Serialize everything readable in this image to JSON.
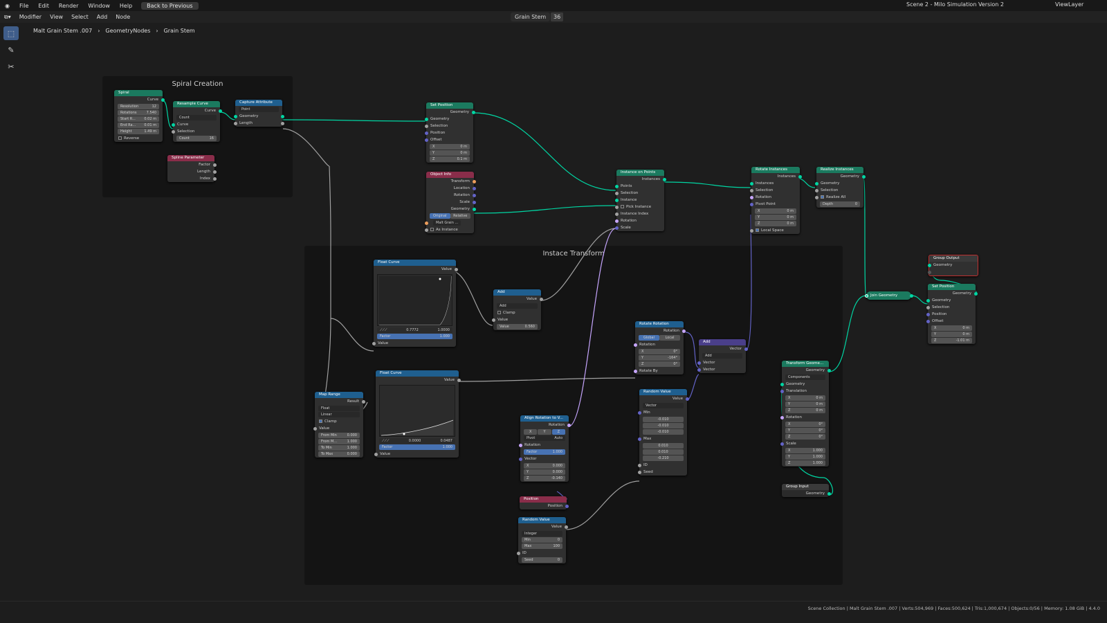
{
  "menu": {
    "editor_label": "Modifier",
    "items": [
      "File",
      "Edit",
      "Render",
      "Window",
      "Help"
    ],
    "back_button": "Back to Previous",
    "scene": "Scene 2 - Milo Simulation Version 2",
    "view_layer": "ViewLayer"
  },
  "header": {
    "items": [
      "View",
      "Select",
      "Add",
      "Node"
    ],
    "node_group": "Grain Stem",
    "user_count": "36"
  },
  "breadcrumb": {
    "object": "Malt Grain Stem .007",
    "modifier": "GeometryNodes",
    "group": "Grain Stem"
  },
  "frames": {
    "spiral": "Spiral Creation",
    "instance": "Instace Transform"
  },
  "nodes": {
    "spiral": {
      "title": "Spiral",
      "out": "Curve",
      "resolution": [
        "Resolution",
        "12"
      ],
      "rotations": [
        "Rotations",
        "7.540"
      ],
      "start": [
        "Start R...",
        "0.02 m"
      ],
      "end": [
        "End Ra...",
        "0.01 m"
      ],
      "height": [
        "Height",
        "1.49 m"
      ],
      "reverse": "Reverse"
    },
    "resample": {
      "title": "Resample Curve",
      "out": "Curve",
      "mode": "Count",
      "in": "Curve",
      "selection": "Selection",
      "count": [
        "Count",
        "16"
      ]
    },
    "capture": {
      "title": "Capture Attribute",
      "domain": "Point",
      "geometry": "Geometry",
      "length": "Length"
    },
    "spline": {
      "title": "Spline Parameter",
      "factor": "Factor",
      "length": "Length",
      "index": "Index"
    },
    "setpos1": {
      "title": "Set Position",
      "out": "Geometry",
      "geometry": "Geometry",
      "selection": "Selection",
      "position": "Position",
      "offset": "Offset",
      "x": [
        "X",
        "0 m"
      ],
      "y": [
        "Y",
        "0 m"
      ],
      "z": [
        "Z",
        "0.1 m"
      ]
    },
    "objinfo": {
      "title": "Object Info",
      "transform": "Transform",
      "location": "Location",
      "rotation": "Rotation",
      "scale": "Scale",
      "geometry": "Geometry",
      "original": "Original",
      "relative": "Relative",
      "object": "Malt Grain ...",
      "as_instance": "As Instance"
    },
    "iop": {
      "title": "Instance on Points",
      "out": "Instances",
      "points": "Points",
      "selection": "Selection",
      "instance": "Instance",
      "pick": "Pick Instance",
      "index": "Instance Index",
      "rotation": "Rotation",
      "scale": "Scale"
    },
    "rotinst": {
      "title": "Rotate Instances",
      "out": "Instances",
      "instances": "Instances",
      "selection": "Selection",
      "rotation": "Rotation",
      "pivot": "Pivot Point",
      "x": [
        "X",
        "0 m"
      ],
      "y": [
        "Y",
        "0 m"
      ],
      "z": [
        "Z",
        "0 m"
      ],
      "local": "Local Space"
    },
    "realize": {
      "title": "Realize Instances",
      "out": "Geometry",
      "geometry": "Geometry",
      "selection": "Selection",
      "realize_all": "Realize All",
      "depth": [
        "Depth",
        "0"
      ]
    },
    "floatcurve1": {
      "title": "Float Curve",
      "out": "Value",
      "pt": [
        "0.7772",
        "1.0000"
      ],
      "factor": [
        "Factor",
        "1.000"
      ],
      "value": "Value"
    },
    "floatcurve2": {
      "title": "Float Curve",
      "out": "Value",
      "pt": [
        "0.0000",
        "0.0487"
      ],
      "factor": [
        "Factor",
        "1.000"
      ],
      "value": "Value"
    },
    "add1": {
      "title": "Add",
      "out": "Value",
      "op": "Add",
      "clamp": "Clamp",
      "value": "Value",
      "value_field": [
        "Value",
        "0.560"
      ]
    },
    "maprange": {
      "title": "Map Range",
      "out": "Result",
      "type": "Float",
      "interp": "Linear",
      "clamp": "Clamp",
      "value": "Value",
      "from_min": [
        "From Min",
        "0.000"
      ],
      "from_max": [
        "From M...",
        "1.000"
      ],
      "to_min": [
        "To Min",
        "1.000"
      ],
      "to_max": [
        "To Max",
        "0.000"
      ]
    },
    "rotrot": {
      "title": "Rotate Rotation",
      "out": "Rotation",
      "global": "Global",
      "local": "Local",
      "rotation": "Rotation",
      "x": [
        "X",
        "0°"
      ],
      "y": [
        "Y",
        "-164°"
      ],
      "z": [
        "Z",
        "0°"
      ],
      "rotate_by": "Rotate By"
    },
    "vadd": {
      "title": "Add",
      "out": "Vector",
      "op": "Add",
      "a": "Vector",
      "b": "Vector"
    },
    "align": {
      "title": "Align Rotation to V...",
      "out": "Rotation",
      "axes": [
        "X",
        "Y",
        "Z"
      ],
      "pivot": [
        "Pivot",
        "Auto"
      ],
      "rotation": "Rotation",
      "factor": [
        "Factor",
        "1.000"
      ],
      "vector": "Vector",
      "x": [
        "X",
        "0.000"
      ],
      "y": [
        "Y",
        "0.000"
      ],
      "z": [
        "Z",
        "-0.140"
      ]
    },
    "rand1": {
      "title": "Random Value",
      "out": "Value",
      "type": "Vector",
      "min": "Min",
      "min_vals": [
        "-0.010",
        "-0.010",
        "-0.010"
      ],
      "max": "Max",
      "max_vals": [
        "0.010",
        "0.010",
        "-0.210"
      ],
      "id": "ID",
      "seed": "Seed"
    },
    "position": {
      "title": "Position",
      "out": "Position"
    },
    "rand2": {
      "title": "Random Value",
      "out": "Value",
      "type": "Integer",
      "min": [
        "Min",
        "0"
      ],
      "max": [
        "Max",
        "100"
      ],
      "id": "ID",
      "seed": [
        "Seed",
        "0"
      ]
    },
    "transform": {
      "title": "Transform Geome...",
      "out": "Geometry",
      "mode": "Components",
      "geometry": "Geometry",
      "translation": "Translation",
      "tx": [
        "X",
        "0 m"
      ],
      "ty": [
        "Y",
        "0 m"
      ],
      "tz": [
        "Z",
        "0 m"
      ],
      "rotation": "Rotation",
      "rx": [
        "X",
        "0°"
      ],
      "ry": [
        "Y",
        "0°"
      ],
      "rz": [
        "Z",
        "0°"
      ],
      "scale": "Scale",
      "sx": [
        "X",
        "1.000"
      ],
      "sy": [
        "Y",
        "1.000"
      ],
      "sz": [
        "Z",
        "1.000"
      ]
    },
    "groupin": {
      "title": "Group Input",
      "out": "Geometry"
    },
    "join": {
      "title": "Join Geometry"
    },
    "groupout": {
      "title": "Group Output",
      "geometry": "Geometry"
    },
    "setpos2": {
      "title": "Set Position",
      "out": "Geometry",
      "geometry": "Geometry",
      "selection": "Selection",
      "position": "Position",
      "offset": "Offset",
      "x": [
        "X",
        "0 m"
      ],
      "y": [
        "Y",
        "0 m"
      ],
      "z": [
        "Z",
        "-1.01 m"
      ]
    }
  },
  "status": "Scene Collection | Malt Grain Stem .007 | Verts:504,969 | Faces:500,624 | Tris:1,000,674 | Objects:0/56 | Memory: 1.08 GiB | 4.4.0"
}
